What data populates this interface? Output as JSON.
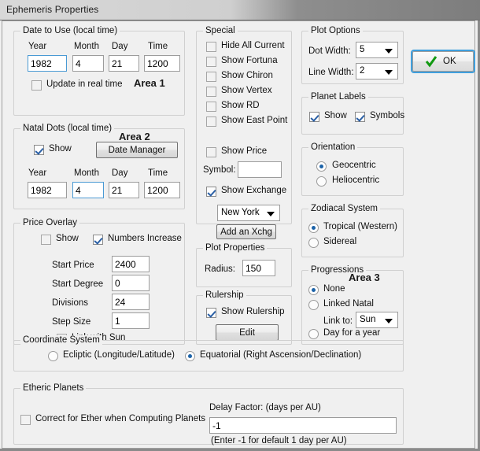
{
  "window": {
    "title": "Ephemeris Properties"
  },
  "ok_button": {
    "label": "OK",
    "icon": "check-icon"
  },
  "area_tags": {
    "area1": "Area 1",
    "area2": "Area 2",
    "area3": "Area 3"
  },
  "date_to_use": {
    "legend": "Date to Use (local time)",
    "fields": [
      {
        "label": "Year",
        "value": "1982"
      },
      {
        "label": "Month",
        "value": "4"
      },
      {
        "label": "Day",
        "value": "21"
      },
      {
        "label": "Time",
        "value": "1200"
      }
    ],
    "update_realtime": {
      "label": "Update in real time",
      "checked": false
    }
  },
  "natal_dots": {
    "legend": "Natal Dots (local time)",
    "show": {
      "label": "Show",
      "checked": true
    },
    "date_manager_button": "Date Manager",
    "fields": [
      {
        "label": "Year",
        "value": "1982"
      },
      {
        "label": "Month",
        "value": "4"
      },
      {
        "label": "Day",
        "value": "21"
      },
      {
        "label": "Time",
        "value": "1200"
      }
    ]
  },
  "price_overlay": {
    "legend": "Price Overlay",
    "show": {
      "label": "Show",
      "checked": false
    },
    "numbers_increase": {
      "label": "Numbers Increase",
      "checked": true
    },
    "fields": [
      {
        "label": "Start Price",
        "value": "2400"
      },
      {
        "label": "Start Degree",
        "value": "0"
      },
      {
        "label": "Divisions",
        "value": "24"
      },
      {
        "label": "Step Size",
        "value": "1"
      }
    ],
    "link_with_sun": {
      "label": "Link with Sun",
      "checked": false
    }
  },
  "special": {
    "legend": "Special",
    "checkboxes": [
      {
        "label": "Hide All Current",
        "checked": false
      },
      {
        "label": "Show Fortuna",
        "checked": false
      },
      {
        "label": "Show Chiron",
        "checked": false
      },
      {
        "label": "Show Vertex",
        "checked": false
      },
      {
        "label": "Show RD",
        "checked": false
      },
      {
        "label": "Show East Point",
        "checked": false
      }
    ],
    "show_price": {
      "label": "Show Price",
      "checked": false
    },
    "symbol_label": "Symbol:",
    "symbol_value": "",
    "show_exchange": {
      "label": "Show Exchange",
      "checked": true
    },
    "exchange_value": "New York",
    "add_exchange_button": "Add an Xchg"
  },
  "plot_properties": {
    "legend": "Plot Properties",
    "radius_label": "Radius:",
    "radius_value": "150"
  },
  "rulership": {
    "legend": "Rulership",
    "show": {
      "label": "Show Rulership",
      "checked": true
    },
    "edit_button": "Edit"
  },
  "plot_options": {
    "legend": "Plot Options",
    "dot_width_label": "Dot Width:",
    "dot_width_value": "5",
    "line_width_label": "Line Width:",
    "line_width_value": "2"
  },
  "planet_labels": {
    "legend": "Planet Labels",
    "show": {
      "label": "Show",
      "checked": true
    },
    "symbols": {
      "label": "Symbols",
      "checked": true
    }
  },
  "orientation": {
    "legend": "Orientation",
    "options": [
      {
        "label": "Geocentric",
        "selected": true
      },
      {
        "label": "Heliocentric",
        "selected": false
      }
    ]
  },
  "zodiacal_system": {
    "legend": "Zodiacal System",
    "options": [
      {
        "label": "Tropical (Western)",
        "selected": true
      },
      {
        "label": "Sidereal",
        "selected": false
      }
    ]
  },
  "progressions": {
    "legend": "Progressions",
    "options": [
      {
        "label": "None",
        "selected": true
      },
      {
        "label": "Linked Natal",
        "selected": false
      },
      {
        "label": "Day for a year",
        "selected": false
      }
    ],
    "link_to_label": "Link to:",
    "link_to_value": "Sun"
  },
  "coordinate_system": {
    "legend": "Coordinate System",
    "options": [
      {
        "label": "Ecliptic (Longitude/Latitude)",
        "selected": false
      },
      {
        "label": "Equatorial (Right Ascension/Declination)",
        "selected": true
      }
    ]
  },
  "etheric_planets": {
    "legend": "Etheric Planets",
    "correct_for_ether": {
      "label": "Correct for Ether when Computing Planets",
      "checked": false
    },
    "delay_factor_label": "Delay Factor: (days per AU)",
    "delay_factor_value": "-1",
    "hint": "(Enter -1 for default 1 day per AU)"
  }
}
